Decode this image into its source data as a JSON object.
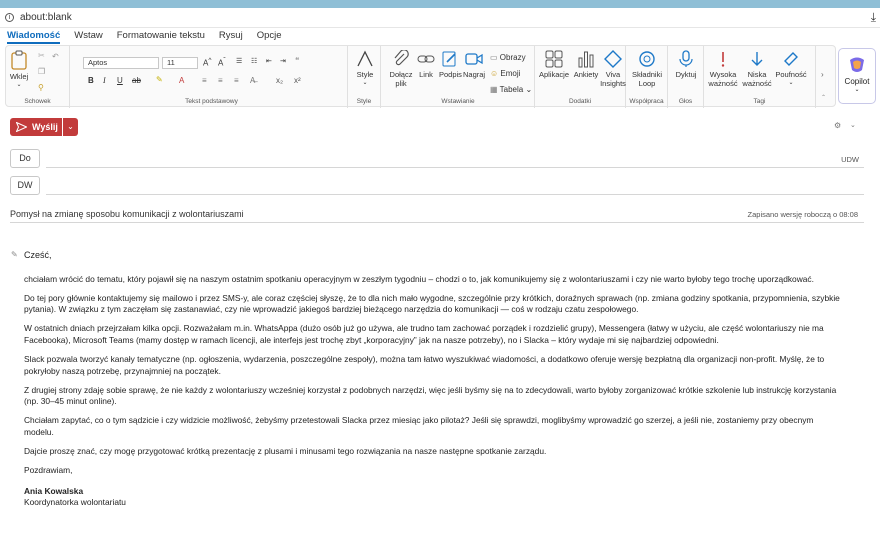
{
  "browser": {
    "url": "about:blank"
  },
  "tabs": [
    "Wiadomość",
    "Wstaw",
    "Formatowanie tekstu",
    "Rysuj",
    "Opcje"
  ],
  "ribbon": {
    "clipboard": {
      "paste": "Wklej",
      "label": "Schowek"
    },
    "font": {
      "name": "Aptos",
      "size": "11",
      "label": "Tekst podstawowy"
    },
    "style": {
      "btn": "Style",
      "label": "Style"
    },
    "insert": {
      "attach": "Dołącz",
      "attach2": "plik",
      "link": "Link",
      "signature": "Podpis",
      "record": "Nagraj",
      "images": "Obrazy",
      "emoji": "Emoji",
      "table": "Tabela",
      "label": "Wstawianie"
    },
    "addins": {
      "apps": "Aplikacje",
      "polls": "Ankiety",
      "viva": "Viva",
      "viva2": "Insights",
      "label": "Dodatki"
    },
    "collab": {
      "loop": "Składniki",
      "loop2": "Loop",
      "label": "Współpraca"
    },
    "voice": {
      "dictate": "Dyktuj",
      "label": "Głos"
    },
    "tags": {
      "high": "Wysoka",
      "high2": "ważność",
      "low": "Niska",
      "low2": "ważność",
      "sensitivity": "Poufność",
      "label": "Tagi"
    },
    "copilot": "Copilot"
  },
  "compose": {
    "send": "Wyślij",
    "to": "Do",
    "cc": "DW",
    "bcc": "UDW",
    "subject": "Pomysł na zmianę sposobu komunikacji z wolontariuszami",
    "draft_status": "Zapisano wersję roboczą o 08:08"
  },
  "body": {
    "greeting": "Cześć,",
    "p1": "chciałam wrócić do tematu, który pojawił się na naszym ostatnim spotkaniu operacyjnym w zeszłym tygodniu – chodzi o to, jak komunikujemy się z wolontariuszami i czy nie warto byłoby tego trochę uporządkować.",
    "p2": "Do tej pory głównie kontaktujemy się mailowo i przez SMS-y, ale coraz częściej słyszę, że to dla nich mało wygodne, szczególnie przy krótkich, doraźnych sprawach (np. zmiana godziny spotkania, przypomnienia, szybkie pytania). W związku z tym zaczęłam się zastanawiać, czy nie wprowadzić jakiegoś bardziej bieżącego narzędzia do komunikacji — coś w rodzaju czatu zespołowego.",
    "p3": "W ostatnich dniach przejrzałam kilka opcji. Rozważałam m.in. WhatsAppa (dużo osób już go używa, ale trudno tam zachować porządek i rozdzielić grupy), Messengera (łatwy w użyciu, ale część wolontariuszy nie ma Facebooka), Microsoft Teams (mamy dostęp w ramach licencji, ale interfejs jest trochę zbyt „korporacyjny” jak na nasze potrzeby), no i Slacka – który wydaje mi się najbardziej odpowiedni.",
    "p4": "Slack pozwala tworzyć kanały tematyczne (np. ogłoszenia, wydarzenia, poszczególne zespoły), można tam łatwo wyszukiwać wiadomości, a dodatkowo oferuje wersję bezpłatną dla organizacji non-profit. Myślę, że to pokryłoby naszą potrzebę, przynajmniej na początek.",
    "p5": "Z drugiej strony zdaję sobie sprawę, że nie każdy z wolontariuszy wcześniej korzystał z podobnych narzędzi, więc jeśli byśmy się na to zdecydowali, warto byłoby zorganizować krótkie szkolenie lub instrukcję korzystania (np. 30–45 minut online).",
    "p6": "Chciałam zapytać, co o tym sądzicie i czy widzicie możliwość, żebyśmy przetestowali Slacka przez miesiąc jako pilotaż? Jeśli się sprawdzi, moglibyśmy wprowadzić go szerzej, a jeśli nie, zostaniemy przy obecnym modelu.",
    "p7": "Dajcie proszę znać, czy mogę przygotować krótką prezentację z plusami i minusami tego rozwiązania na nasze następne spotkanie zarządu.",
    "closing": "Pozdrawiam,",
    "name": "Ania Kowalska",
    "role": "Koordynatorka wolontariatu"
  }
}
